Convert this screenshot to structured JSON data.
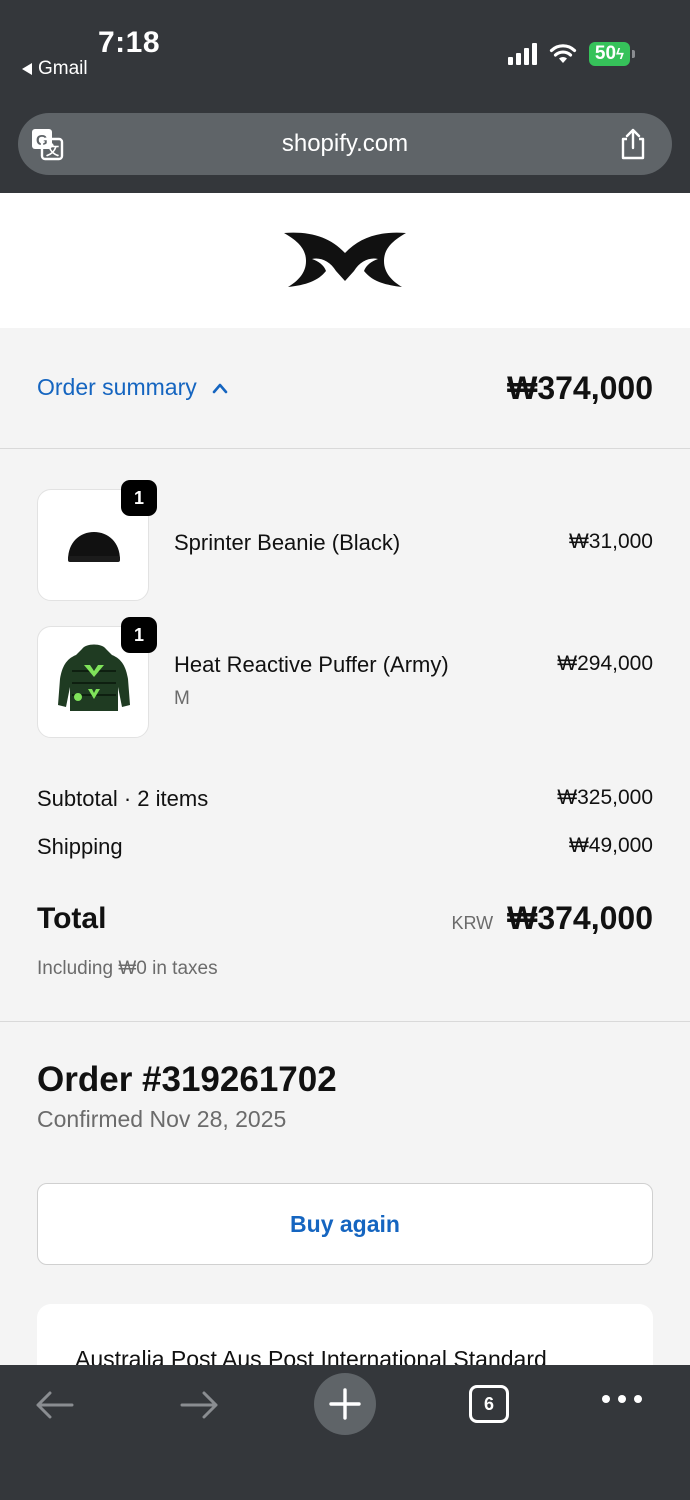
{
  "status_bar": {
    "time": "7:18",
    "back_app": "Gmail",
    "battery": "50"
  },
  "browser": {
    "url": "shopify.com",
    "tab_count": "6"
  },
  "summary": {
    "toggle_label": "Order summary",
    "total": "₩374,000"
  },
  "items": [
    {
      "name": "Sprinter Beanie (Black)",
      "variant": "",
      "price": "₩31,000",
      "qty": "1"
    },
    {
      "name": "Heat Reactive Puffer (Army)",
      "variant": "M",
      "price": "₩294,000",
      "qty": "1"
    }
  ],
  "totals": {
    "subtotal_label": "Subtotal · 2 items",
    "subtotal_value": "₩325,000",
    "shipping_label": "Shipping",
    "shipping_value": "₩49,000",
    "total_label": "Total",
    "currency": "KRW",
    "total_value": "₩374,000",
    "tax_note": "Including ₩0 in taxes"
  },
  "order": {
    "number": "Order #319261702",
    "confirmed": "Confirmed Nov 28, 2025",
    "buy_again": "Buy again",
    "shipping_method": "Australia Post Aus Post International Standard"
  },
  "colors": {
    "link": "#1565c0",
    "chrome": "#34373b",
    "battery": "#36c25a"
  }
}
